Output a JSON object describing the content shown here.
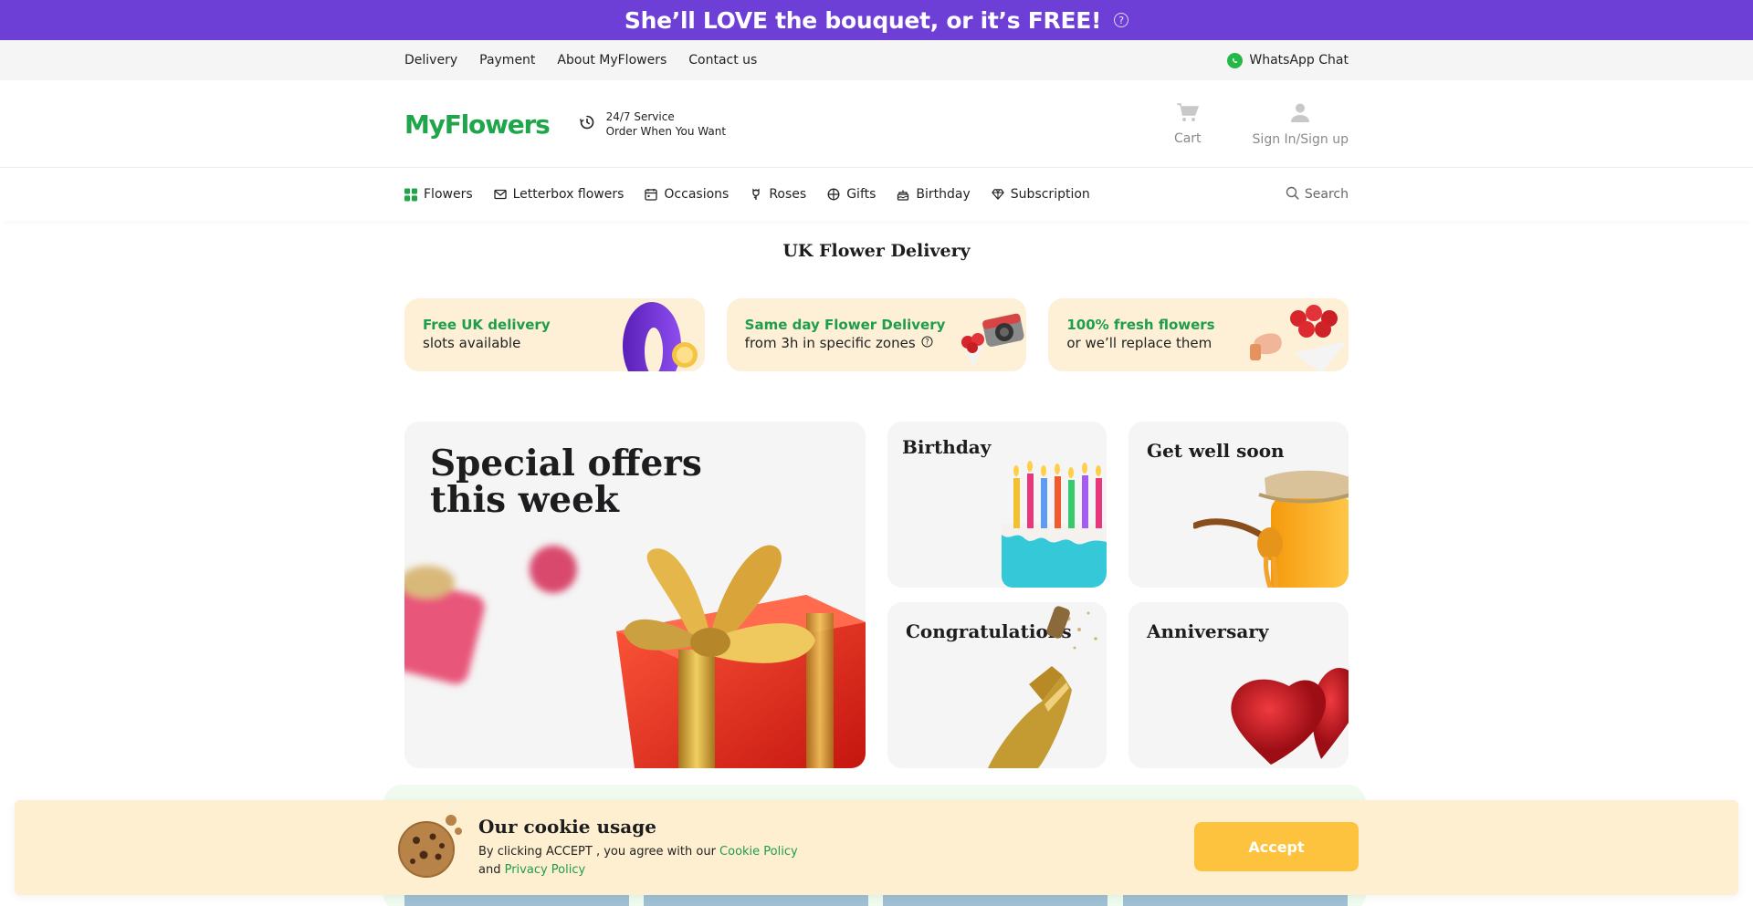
{
  "promo": {
    "text": "She’ll LOVE the bouquet, or it’s FREE!",
    "help": "?"
  },
  "utility": {
    "links": [
      "Delivery",
      "Payment",
      "About MyFlowers",
      "Contact us"
    ],
    "whatsapp": "WhatsApp Chat"
  },
  "header": {
    "logo": "MyFlowers",
    "service_line1": "24/7 Service",
    "service_line2": "Order When You Want",
    "cart": "Cart",
    "signin": "Sign In/Sign up"
  },
  "nav": {
    "items": [
      {
        "label": "Flowers",
        "icon": "grid-icon"
      },
      {
        "label": "Letterbox flowers",
        "icon": "envelope-icon"
      },
      {
        "label": "Occasions",
        "icon": "calendar-icon"
      },
      {
        "label": "Roses",
        "icon": "rose-icon"
      },
      {
        "label": "Gifts",
        "icon": "gift-icon"
      },
      {
        "label": "Birthday",
        "icon": "cake-icon"
      },
      {
        "label": "Subscription",
        "icon": "diamond-icon"
      }
    ],
    "search": "Search"
  },
  "page_title": "UK Flower Delivery",
  "benefits": [
    {
      "line1": "Free UK delivery",
      "line2": "slots available"
    },
    {
      "line1": "Same day Flower Delivery",
      "line2": "from 3h in specific zones"
    },
    {
      "line1": "100% fresh flowers",
      "line2": "or we’ll replace them"
    }
  ],
  "tiles": {
    "special_line1": "Special offers",
    "special_line2": "this week",
    "birthday": "Birthday",
    "get_well": "Get well soon",
    "congrats": "Congratulations",
    "anniversary": "Anniversary"
  },
  "cookie": {
    "title": "Our cookie usage",
    "text_before": "By clicking ACCEPT , you agree with our ",
    "cookie_policy": "Cookie Policy",
    "and": "and ",
    "privacy_policy": "Privacy Policy",
    "accept": "Accept"
  },
  "colors": {
    "promo_bg": "#6e3fd6",
    "brand_green": "#1fa64a",
    "benefit_bg": "#fdf0d6",
    "accept_bg": "#fec33e"
  }
}
